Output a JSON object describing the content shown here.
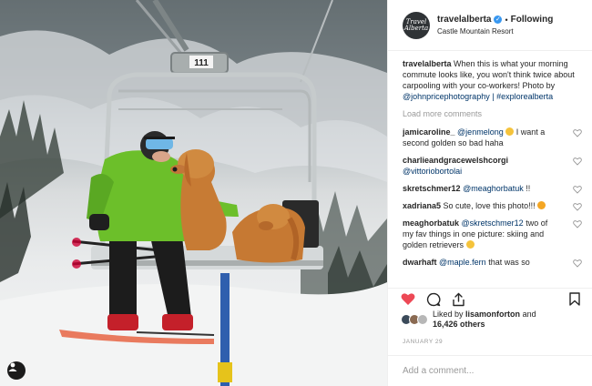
{
  "header": {
    "avatar_text": "Travel Alberta",
    "username": "travelalberta",
    "separator": "•",
    "follow_status": "Following",
    "location": "Castle Mountain Resort"
  },
  "photo": {
    "chair_number": "111"
  },
  "caption": {
    "username": "travelalberta",
    "text": "When this is what your morning commute looks like, you won't think twice about carpooling with your co-workers! Photo by",
    "mention": "@johnpricephotography",
    "separator": "|",
    "hashtag": "#explorealberta"
  },
  "load_more": "Load more comments",
  "comments": [
    {
      "user": "jamicaroline_",
      "mention": "@jenmelong",
      "emoji": "sad-face",
      "text": "I want a second golden so bad haha"
    },
    {
      "user": "charlieandgracewelshcorgi",
      "mention": "@vittoriobortolai",
      "text": ""
    },
    {
      "user": "skretschmer12",
      "mention": "@meaghorbatuk",
      "text": "!!"
    },
    {
      "user": "xadriana5",
      "mention": "",
      "text": "So cute, love this photo!!!",
      "emoji": "heart-eyes"
    },
    {
      "user": "meaghorbatuk",
      "mention": "@skretschmer12",
      "text": "two of my fav things in one picture: skiing and golden retrievers",
      "emoji": "grin"
    },
    {
      "user": "dwarhaft",
      "mention": "@maple.fern",
      "text": "that was so"
    }
  ],
  "likes": {
    "prefix": "Liked by",
    "user": "lisamonforton",
    "and": "and",
    "count": "16,426 others"
  },
  "date": "January 29",
  "add_comment_placeholder": "Add a comment...",
  "colors": {
    "accent_blue": "#3897f0",
    "like_red": "#ed4956",
    "link_blue": "#003569",
    "muted": "#999999"
  }
}
